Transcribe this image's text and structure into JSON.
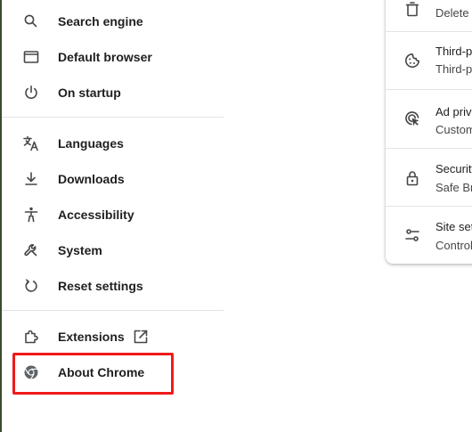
{
  "sidebar": {
    "items": [
      {
        "label": "Search engine",
        "icon": "search-icon"
      },
      {
        "label": "Default browser",
        "icon": "browser-window-icon"
      },
      {
        "label": "On startup",
        "icon": "power-icon"
      },
      {
        "label": "Languages",
        "icon": "translate-icon"
      },
      {
        "label": "Downloads",
        "icon": "download-icon"
      },
      {
        "label": "Accessibility",
        "icon": "accessibility-icon"
      },
      {
        "label": "System",
        "icon": "wrench-icon"
      },
      {
        "label": "Reset settings",
        "icon": "reset-icon"
      },
      {
        "label": "Extensions",
        "icon": "puzzle-icon",
        "trailing_icon": "open-in-new-icon"
      },
      {
        "label": "About Chrome",
        "icon": "chrome-icon"
      }
    ],
    "highlighted_item": "About Chrome",
    "highlight_color": "#f01a1a"
  },
  "privacy_card": {
    "rows": [
      {
        "title": "",
        "subtitle": "Delete",
        "icon": "trash-icon"
      },
      {
        "title": "Third-p",
        "subtitle": "Third-p",
        "icon": "cookie-icon"
      },
      {
        "title": "Ad priv",
        "subtitle": "Custom",
        "icon": "ad-privacy-icon"
      },
      {
        "title": "Security",
        "subtitle": "Safe Br",
        "icon": "lock-icon"
      },
      {
        "title": "Site set",
        "subtitle": "Control",
        "icon": "tune-icon"
      }
    ]
  }
}
